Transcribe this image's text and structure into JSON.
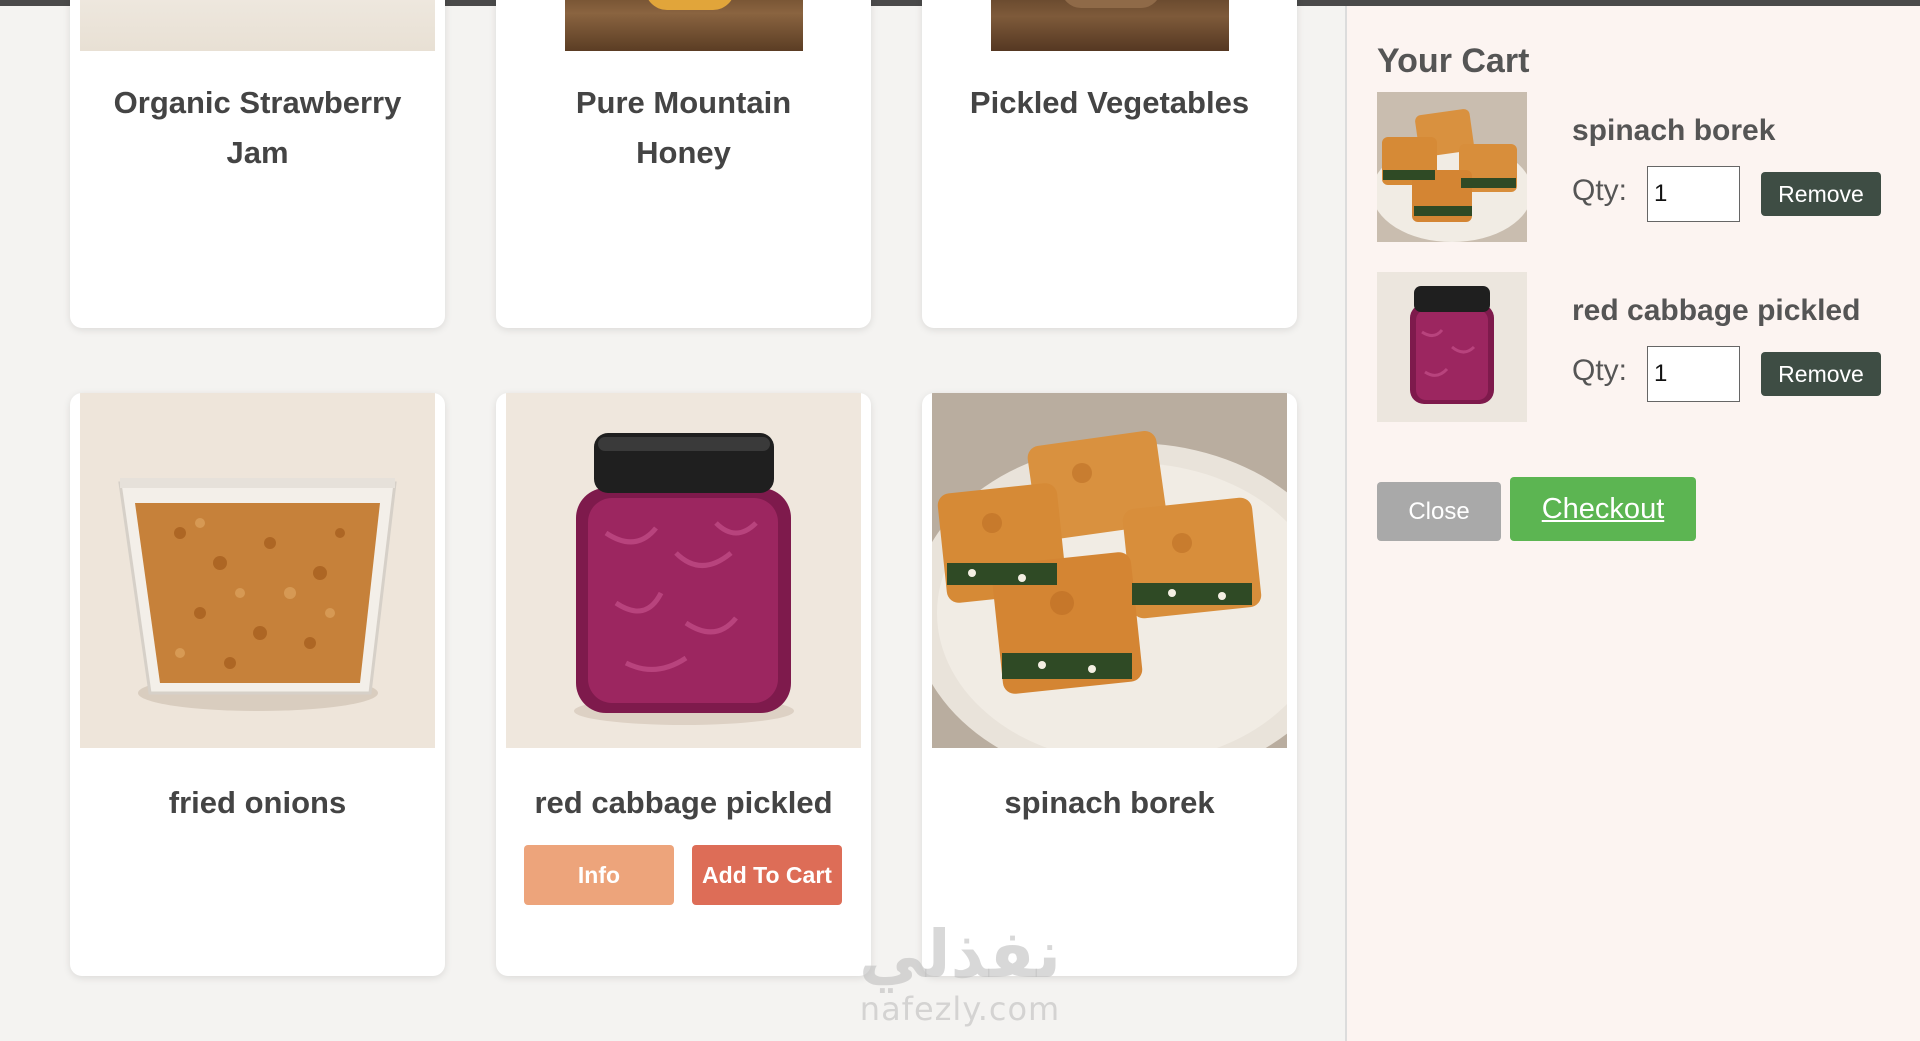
{
  "products": [
    {
      "name": "Organic Strawberry Jam",
      "image": "strawberry-jam-image"
    },
    {
      "name": "Pure Mountain Honey",
      "image": "honey-jar-image"
    },
    {
      "name": "Pickled Vegetables",
      "image": "pickled-vegetables-image"
    },
    {
      "name": "fried onions",
      "image": "fried-onions-image"
    },
    {
      "name": "red cabbage pickled",
      "image": "red-cabbage-jar-image",
      "info_label": "Info",
      "add_label": "Add To Cart"
    },
    {
      "name": "spinach borek",
      "image": "spinach-borek-image"
    }
  ],
  "cart": {
    "title": "Your Cart",
    "items": [
      {
        "name": "spinach borek",
        "qty_label": "Qty:",
        "qty": "1",
        "remove_label": "Remove"
      },
      {
        "name": "red cabbage pickled",
        "qty_label": "Qty:",
        "qty": "1",
        "remove_label": "Remove"
      }
    ],
    "close_label": "Close",
    "checkout_label": "Checkout"
  },
  "colors": {
    "info_button": "#eda47b",
    "add_button": "#dd6d57",
    "checkout_button": "#5cb552",
    "remove_button": "#3e4d44",
    "close_button": "#a9a9a9"
  },
  "watermark": {
    "arabic": "نفذلي",
    "latin": "nafezly.com"
  }
}
